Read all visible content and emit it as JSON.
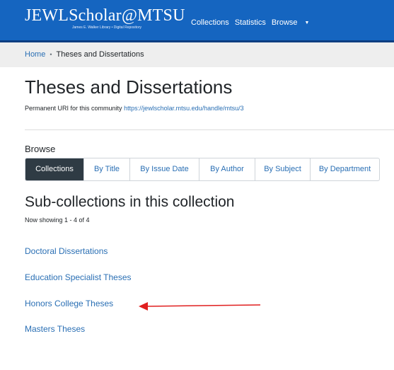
{
  "navbar": {
    "logo_title": "JEWLScholar@MTSU",
    "logo_subtitle": "James E. Walker Library • Digital Repository",
    "links": [
      "Collections",
      "Statistics",
      "Browse"
    ]
  },
  "breadcrumb": {
    "home": "Home",
    "separator": "•",
    "current": "Theses and Dissertations"
  },
  "page": {
    "title": "Theses and Dissertations",
    "uri_label": "Permanent URI for this community",
    "uri_link": "https://jewlscholar.mtsu.edu/handle/mtsu/3"
  },
  "browse": {
    "label": "Browse",
    "tabs": [
      "Collections",
      "By Title",
      "By Issue Date",
      "By Author",
      "By Subject",
      "By Department"
    ],
    "active_tab": "Collections"
  },
  "subcollections": {
    "title": "Sub-collections in this collection",
    "showing": "Now showing 1 - 4 of 4",
    "items": [
      "Doctoral Dissertations",
      "Education Specialist Theses",
      "Honors College Theses",
      "Masters Theses"
    ]
  },
  "colors": {
    "navbar": "#1565c0",
    "link": "#2a6fb4",
    "active_tab": "#2f3b44",
    "annotation_arrow": "#e01f1f"
  },
  "icons": [
    "chevron-down-icon",
    "annotation-arrow"
  ]
}
